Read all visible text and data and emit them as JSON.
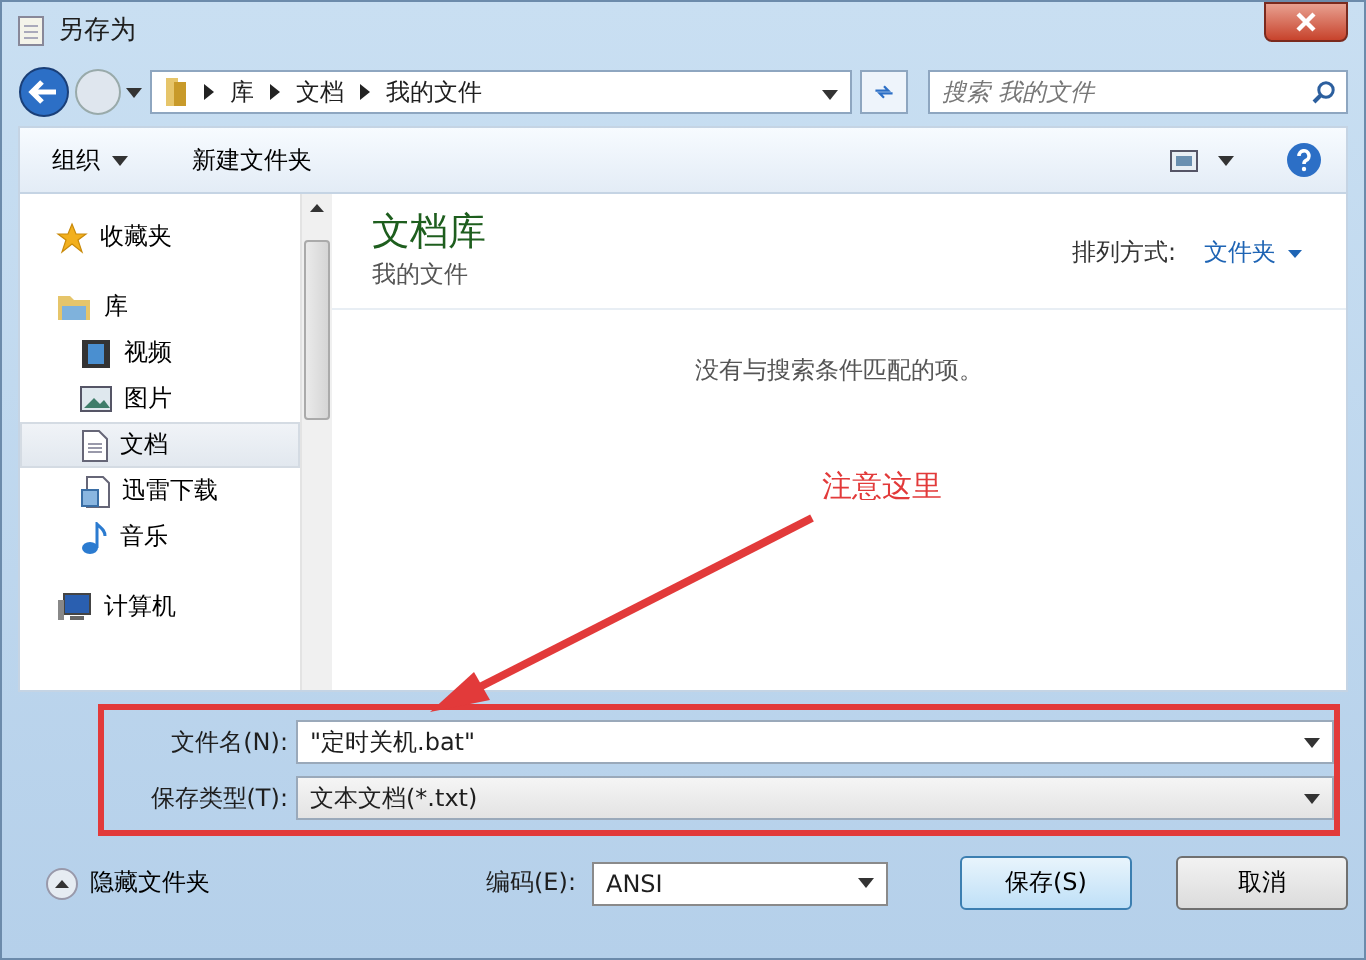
{
  "window": {
    "title": "另存为"
  },
  "address": {
    "path": [
      "库",
      "文档",
      "我的文件"
    ]
  },
  "search": {
    "placeholder": "搜索 我的文件"
  },
  "toolbar": {
    "buttons": [
      {
        "label": "组织",
        "kind": "menu"
      },
      {
        "label": "新建文件夹",
        "kind": "plain"
      }
    ]
  },
  "sidebar": {
    "items": [
      {
        "label": "收藏夹",
        "kind": "star",
        "selected": false
      },
      {
        "label": "库",
        "kind": "library",
        "selected": false,
        "children": [
          {
            "label": "视频",
            "kind": "video",
            "selected": false
          },
          {
            "label": "图片",
            "kind": "picture",
            "selected": false
          },
          {
            "label": "文档",
            "kind": "document",
            "selected": true
          },
          {
            "label": "迅雷下载",
            "kind": "download",
            "selected": false
          },
          {
            "label": "音乐",
            "kind": "music",
            "selected": false
          }
        ]
      },
      {
        "label": "计算机",
        "kind": "computer",
        "selected": false
      }
    ]
  },
  "content": {
    "title": "文档库",
    "subtitle": "我的文件",
    "sort_label": "排列方式:",
    "sort_value": "文件夹",
    "empty_message": "没有与搜索条件匹配的项。"
  },
  "form": {
    "fields": [
      {
        "label": "文件名(N):",
        "value": "\"定时关机.bat\"",
        "kind": "input"
      },
      {
        "label": "保存类型(T):",
        "value": "文本文档(*.txt)",
        "kind": "select"
      }
    ]
  },
  "hide_folders": "隐藏文件夹",
  "encoding": {
    "label": "编码(E):",
    "value": "ANSI"
  },
  "buttons": [
    {
      "label": "保存(S)",
      "default": true
    },
    {
      "label": "取消",
      "default": false
    }
  ],
  "annotation": {
    "text": "注意这里"
  }
}
